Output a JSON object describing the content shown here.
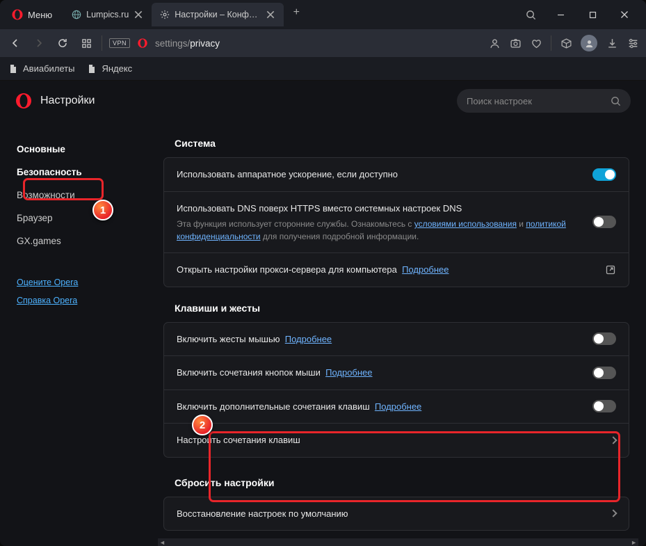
{
  "menu_label": "Меню",
  "tabs": [
    {
      "label": "Lumpics.ru"
    },
    {
      "label": "Настройки – Конфиденци"
    }
  ],
  "url_host": "settings/",
  "url_path": "privacy",
  "bookmarks": [
    {
      "label": "Авиабилеты"
    },
    {
      "label": "Яндекс"
    }
  ],
  "settings_title": "Настройки",
  "search_placeholder": "Поиск настроек",
  "sidebar": {
    "items": [
      {
        "label": "Основные"
      },
      {
        "label": "Безопасность"
      },
      {
        "label": "Возможности"
      },
      {
        "label": "Браузер"
      },
      {
        "label": "GX.games"
      }
    ],
    "links": [
      {
        "label": "Оцените Opera"
      },
      {
        "label": "Справка Opera"
      }
    ]
  },
  "sections": {
    "system": {
      "title": "Система",
      "hw_accel": "Использовать аппаратное ускорение, если доступно",
      "dns_https": "Использовать DNS поверх HTTPS вместо системных настроек DNS",
      "dns_sub_a": "Эта функция использует сторонние службы. Ознакомьтесь с ",
      "dns_link1": "условиями использования",
      "dns_sub_b": " и ",
      "dns_link2": "политикой конфиденциальности",
      "dns_sub_c": " для получения подробной информации.",
      "proxy": "Открыть настройки прокси-сервера для компьютера",
      "proxy_link": "Подробнее"
    },
    "gestures": {
      "title": "Клавиши и жесты",
      "mouse": "Включить жесты мышью",
      "rocker": "Включить сочетания кнопок мыши",
      "extra": "Включить дополнительные сочетания клавиш",
      "more": "Подробнее",
      "configure": "Настроить сочетания клавиш"
    },
    "reset": {
      "title": "Сбросить настройки",
      "restore": "Восстановление настроек по умолчанию"
    }
  }
}
